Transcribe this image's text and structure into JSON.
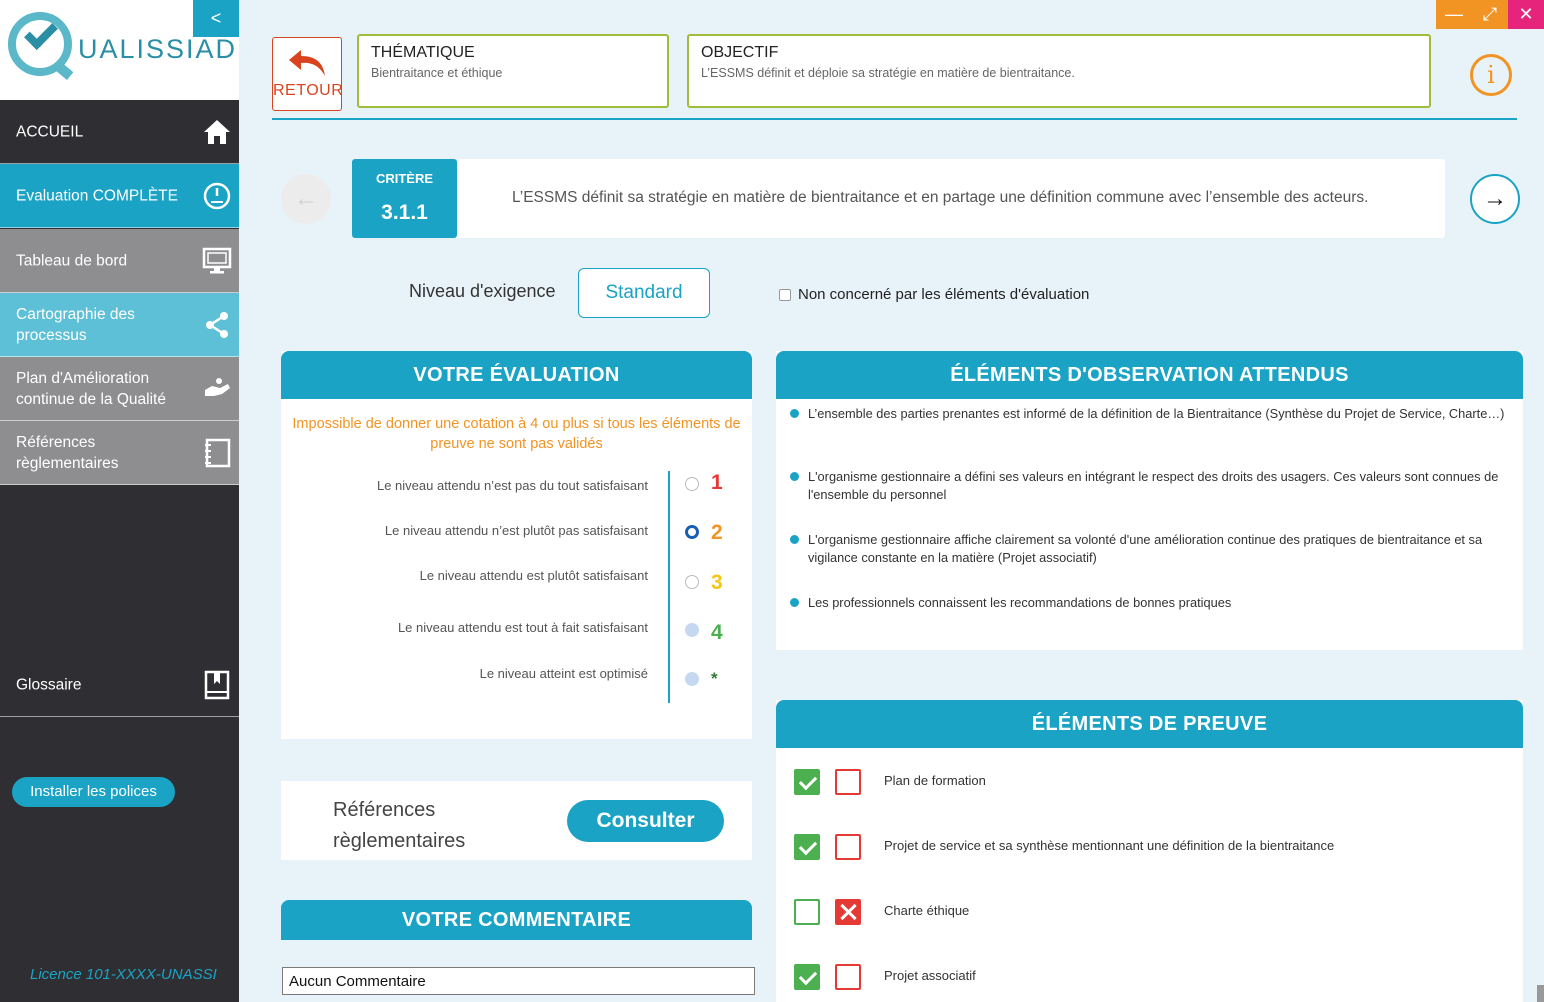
{
  "app": {
    "logo_text": "UALISSIAD",
    "collapse_label": "<"
  },
  "window": {
    "minimize": "—",
    "maximize": "⤢",
    "close": "✕"
  },
  "sidebar": {
    "items": [
      {
        "label": "ACCUEIL",
        "icon": "home-icon"
      },
      {
        "label": "Evaluation COMPLÈTE",
        "icon": "gauge-icon"
      },
      {
        "label": "Tableau de bord",
        "icon": "monitor-icon"
      },
      {
        "label": "Cartographie des processus",
        "icon": "share-icon"
      },
      {
        "label": "Plan d'Amélioration continue de la Qualité",
        "icon": "hand-icon"
      },
      {
        "label": "Références règlementaires",
        "icon": "notebook-icon"
      }
    ],
    "glossaire": "Glossaire",
    "install": "Installer les polices",
    "licence": "Licence 101-XXXX-UNASSI"
  },
  "header": {
    "retour": "RETOUR",
    "thematique": {
      "title": "THÉMATIQUE",
      "text": "Bientraitance et éthique"
    },
    "objectif": {
      "title": "OBJECTIF",
      "text": "L’ESSMS définit et déploie sa stratégie en matière de bientraitance."
    },
    "info": "i"
  },
  "critere": {
    "title": "CRITÈRE",
    "number": "3.1.1",
    "text": "L’ESSMS définit sa stratégie en matière de bientraitance et en partage une définition commune avec l’ensemble des acteurs.",
    "prev": "←",
    "next": "→"
  },
  "niveau": {
    "label": "Niveau d'exigence",
    "value": "Standard"
  },
  "non_concerne": "Non concerné par les éléments d'évaluation",
  "evaluation": {
    "title": "VOTRE ÉVALUATION",
    "warning": "Impossible de donner une cotation à 4 ou plus si tous les éléments de preuve ne sont pas validés",
    "selected": 2,
    "levels": [
      {
        "text": "Le niveau attendu n’est pas du tout satisfaisant",
        "num": "1",
        "color": "#e53935",
        "state": "empty"
      },
      {
        "text": "Le niveau attendu n’est plutôt pas satisfaisant",
        "num": "2",
        "color": "#f29423",
        "state": "selected"
      },
      {
        "text": "Le niveau attendu est plutôt satisfaisant",
        "num": "3",
        "color": "#f5c518",
        "state": "empty"
      },
      {
        "text": "Le niveau attendu est tout à fait satisfaisant",
        "num": "4",
        "color": "#4caf50",
        "state": "disabled"
      },
      {
        "text": "Le niveau atteint est optimisé",
        "num": "*",
        "color": "#2e7d32",
        "state": "disabled"
      }
    ]
  },
  "references": {
    "label_line1": "Références",
    "label_line2": "règlementaires",
    "button": "Consulter"
  },
  "commentaire": {
    "title": "VOTRE COMMENTAIRE",
    "value": "Aucun Commentaire"
  },
  "observation": {
    "title": "ÉLÉMENTS D'OBSERVATION ATTENDUS",
    "items": [
      "L’ensemble des parties prenantes est informé de la définition de la Bientraitance (Synthèse du Projet de Service, Charte…)",
      "L'organisme gestionnaire a défini ses valeurs en intégrant le respect des droits des usagers. Ces valeurs sont connues de l'ensemble du personnel",
      "L'organisme gestionnaire affiche clairement sa volonté d'une amélioration continue des pratiques de bientraitance et sa vigilance constante en la matière (Projet associatif)",
      "Les professionnels connaissent les recommandations de bonnes pratiques"
    ]
  },
  "preuve": {
    "title": "ÉLÉMENTS DE PREUVE",
    "items": [
      {
        "text": "Plan de formation",
        "ok": true,
        "ko": false
      },
      {
        "text": "Projet de service et sa synthèse mentionnant une définition de la bientraitance",
        "ok": true,
        "ko": false
      },
      {
        "text": "Charte éthique",
        "ok": false,
        "ko": true
      },
      {
        "text": "Projet associatif",
        "ok": true,
        "ko": false
      }
    ]
  }
}
